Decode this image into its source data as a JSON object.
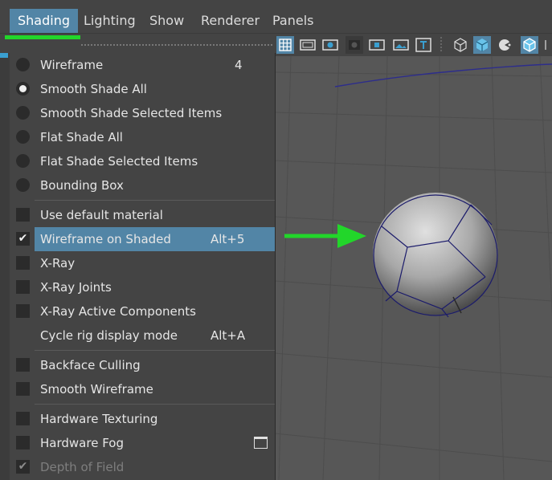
{
  "menubar": {
    "items": [
      {
        "label": "Shading",
        "active": true
      },
      {
        "label": "Lighting"
      },
      {
        "label": "Show"
      },
      {
        "label": "Renderer"
      },
      {
        "label": "Panels"
      }
    ]
  },
  "menu": {
    "wireframe": {
      "label": "Wireframe",
      "shortcut": "4"
    },
    "smooth_shade_all": {
      "label": "Smooth Shade All"
    },
    "smooth_shade_selected": {
      "label": "Smooth Shade Selected Items"
    },
    "flat_shade_all": {
      "label": "Flat Shade All"
    },
    "flat_shade_selected": {
      "label": "Flat Shade Selected Items"
    },
    "bounding_box": {
      "label": "Bounding Box"
    },
    "use_default_material": {
      "label": "Use default material"
    },
    "wireframe_on_shaded": {
      "label": "Wireframe on Shaded",
      "shortcut": "Alt+5"
    },
    "xray": {
      "label": "X-Ray"
    },
    "xray_joints": {
      "label": "X-Ray Joints"
    },
    "xray_active": {
      "label": "X-Ray Active Components"
    },
    "cycle_rig": {
      "label": "Cycle rig display mode",
      "shortcut": "Alt+A"
    },
    "backface_culling": {
      "label": "Backface Culling"
    },
    "smooth_wireframe": {
      "label": "Smooth Wireframe"
    },
    "hardware_texturing": {
      "label": "Hardware Texturing"
    },
    "hardware_fog": {
      "label": "Hardware Fog"
    },
    "depth_of_field": {
      "label": "Depth of Field"
    }
  },
  "colors": {
    "accent": "#5285a6",
    "annotation_green": "#22d62a",
    "menu_bg": "#444444",
    "viewport_bg": "#575757"
  }
}
